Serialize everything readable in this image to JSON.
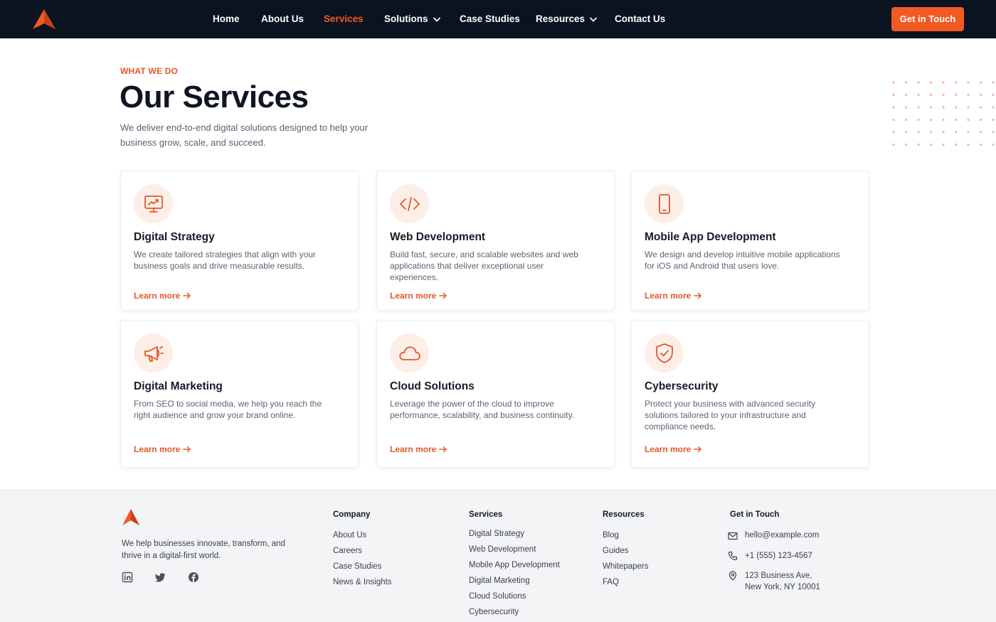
{
  "nav": {
    "items": [
      {
        "label": "Home"
      },
      {
        "label": "About Us"
      },
      {
        "label": "Services"
      },
      {
        "label": "Solutions"
      },
      {
        "label": "Case Studies"
      },
      {
        "label": "Resources"
      },
      {
        "label": "Contact Us"
      }
    ],
    "active_item": "Services",
    "cta_label": "Get in Touch",
    "logo_icon": "logo-triangle-icon"
  },
  "hero": {
    "eyebrow": "WHAT WE DO",
    "title": "Our Services",
    "subtitle": "We deliver end-to-end digital solutions designed to help your business grow, scale, and succeed."
  },
  "services": [
    {
      "title": "Digital Strategy",
      "description": "We create tailored strategies that align with your business goals and drive measurable results.",
      "link": "Learn more",
      "icon": "monitor-chart-icon"
    },
    {
      "title": "Web Development",
      "description": "Build fast, secure, and scalable websites and web applications that deliver exceptional user experiences.",
      "link": "Learn more",
      "icon": "code-icon"
    },
    {
      "title": "Mobile App Development",
      "description": "We design and develop intuitive mobile applications for iOS and Android that users love.",
      "link": "Learn more",
      "icon": "smartphone-icon"
    },
    {
      "title": "Digital Marketing",
      "description": "From SEO to social media, we help you reach the right audience and grow your brand online.",
      "link": "Learn more",
      "icon": "megaphone-icon"
    },
    {
      "title": "Cloud Solutions",
      "description": "Leverage the power of the cloud to improve performance, scalability, and business continuity.",
      "link": "Learn more",
      "icon": "cloud-icon"
    },
    {
      "title": "Cybersecurity",
      "description": "Protect your business with advanced security solutions tailored to your infrastructure and compliance needs.",
      "link": "Learn more",
      "icon": "shield-check-icon"
    }
  ],
  "footer": {
    "tagline": "We help businesses innovate, transform, and thrive in a digital-first world.",
    "social": [
      "linkedin-icon",
      "twitter-icon",
      "facebook-icon"
    ],
    "columns": {
      "company": {
        "title": "Company",
        "links": [
          "About Us",
          "Careers",
          "Case Studies",
          "News & Insights"
        ]
      },
      "services": {
        "title": "Services",
        "links": [
          "Digital Strategy",
          "Web Development",
          "Mobile App Development",
          "Digital Marketing",
          "Cloud Solutions",
          "Cybersecurity"
        ]
      },
      "resources": {
        "title": "Resources",
        "links": [
          "Blog",
          "Guides",
          "Whitepapers",
          "FAQ"
        ]
      }
    },
    "contact": {
      "title": "Get in Touch",
      "email": "hello@example.com",
      "phone": "+1 (555) 123-4567",
      "address_line1": "123 Business Ave,",
      "address_line2": "New York, NY 10001"
    }
  },
  "colors": {
    "accent": "#f15a22",
    "nav_bg": "#0b1220",
    "footer_bg": "#f3f4f6",
    "icon_bg": "#fdeee8"
  }
}
